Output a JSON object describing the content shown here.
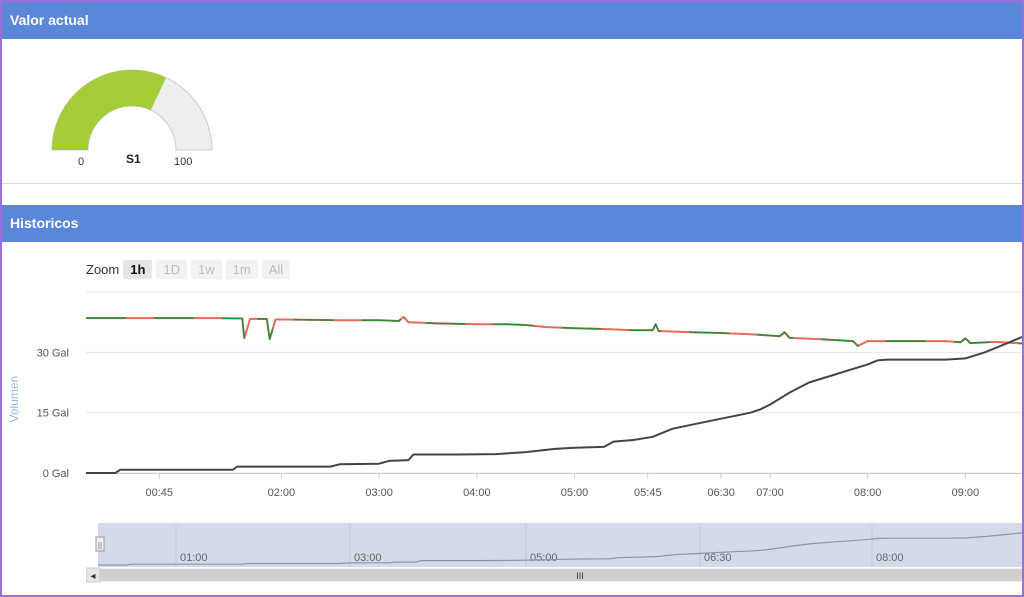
{
  "panels": {
    "current": {
      "title": "Valor actual"
    },
    "history": {
      "title": "Historicos"
    }
  },
  "gauge": {
    "name": "S1",
    "min_label": "0",
    "max_label": "100",
    "value": 64,
    "fill_color": "#a4cd3a",
    "track_color": "#eeeeee"
  },
  "zoom": {
    "label": "Zoom",
    "buttons": [
      {
        "label": "1h",
        "active": true
      },
      {
        "label": "1D",
        "active": false
      },
      {
        "label": "1w",
        "active": false
      },
      {
        "label": "1m",
        "active": false
      },
      {
        "label": "All",
        "active": false
      }
    ]
  },
  "chart_data": {
    "type": "line",
    "ylabel": "Volumen",
    "yticks": [
      "0 Gal",
      "15 Gal",
      "30 Gal"
    ],
    "ylim": [
      0,
      45
    ],
    "xticks": [
      {
        "label": "00:45",
        "t": 0.75
      },
      {
        "label": "02:00",
        "t": 2.0
      },
      {
        "label": "03:00",
        "t": 3.0
      },
      {
        "label": "04:00",
        "t": 4.0
      },
      {
        "label": "05:00",
        "t": 5.0
      },
      {
        "label": "05:45",
        "t": 5.75
      },
      {
        "label": "06:30",
        "t": 6.5
      },
      {
        "label": "07:00",
        "t": 7.0
      },
      {
        "label": "08:00",
        "t": 8.0
      },
      {
        "label": "09:00",
        "t": 9.0
      }
    ],
    "xlim": [
      0.0,
      9.6
    ],
    "series": [
      {
        "color": "#2e8b3a",
        "alt_color": "#e86b5a",
        "points": [
          [
            0.0,
            38.5
          ],
          [
            1.35,
            38.5
          ],
          [
            1.6,
            38.4
          ],
          [
            1.62,
            33.5
          ],
          [
            1.68,
            38.3
          ],
          [
            1.85,
            38.3
          ],
          [
            1.88,
            33.3
          ],
          [
            1.94,
            38.2
          ],
          [
            2.6,
            38.0
          ],
          [
            3.0,
            38.0
          ],
          [
            3.2,
            37.8
          ],
          [
            3.25,
            38.8
          ],
          [
            3.3,
            37.5
          ],
          [
            3.6,
            37.2
          ],
          [
            4.0,
            37.0
          ],
          [
            4.3,
            37.0
          ],
          [
            4.5,
            36.8
          ],
          [
            4.7,
            36.3
          ],
          [
            5.0,
            36.0
          ],
          [
            5.3,
            35.8
          ],
          [
            5.6,
            35.5
          ],
          [
            5.8,
            35.5
          ],
          [
            5.83,
            37.0
          ],
          [
            5.86,
            35.3
          ],
          [
            6.2,
            35.0
          ],
          [
            6.5,
            34.8
          ],
          [
            6.8,
            34.5
          ],
          [
            7.1,
            34.0
          ],
          [
            7.15,
            35.0
          ],
          [
            7.2,
            33.6
          ],
          [
            7.5,
            33.3
          ],
          [
            7.7,
            33.0
          ],
          [
            7.85,
            32.8
          ],
          [
            7.9,
            31.6
          ],
          [
            8.0,
            32.8
          ],
          [
            8.8,
            32.8
          ],
          [
            8.95,
            32.5
          ],
          [
            9.0,
            33.5
          ],
          [
            9.05,
            32.3
          ],
          [
            9.3,
            32.6
          ],
          [
            9.6,
            32.2
          ]
        ]
      },
      {
        "color": "#444444",
        "points": [
          [
            0.0,
            0.0
          ],
          [
            0.3,
            0.0
          ],
          [
            0.35,
            0.8
          ],
          [
            1.5,
            0.8
          ],
          [
            1.55,
            1.6
          ],
          [
            2.5,
            1.6
          ],
          [
            2.6,
            2.2
          ],
          [
            3.0,
            2.3
          ],
          [
            3.1,
            3.0
          ],
          [
            3.3,
            3.2
          ],
          [
            3.35,
            4.6
          ],
          [
            3.8,
            4.6
          ],
          [
            4.2,
            4.7
          ],
          [
            4.5,
            5.2
          ],
          [
            4.8,
            6.0
          ],
          [
            5.0,
            6.3
          ],
          [
            5.3,
            6.5
          ],
          [
            5.4,
            7.8
          ],
          [
            5.6,
            8.2
          ],
          [
            5.8,
            9.0
          ],
          [
            6.0,
            11.0
          ],
          [
            6.2,
            12.0
          ],
          [
            6.4,
            13.0
          ],
          [
            6.6,
            14.0
          ],
          [
            6.8,
            15.0
          ],
          [
            6.9,
            15.8
          ],
          [
            7.0,
            17.0
          ],
          [
            7.2,
            20.0
          ],
          [
            7.4,
            22.5
          ],
          [
            7.6,
            24.0
          ],
          [
            7.8,
            25.5
          ],
          [
            8.0,
            27.0
          ],
          [
            8.1,
            28.0
          ],
          [
            8.2,
            28.2
          ],
          [
            8.8,
            28.2
          ],
          [
            9.0,
            28.5
          ],
          [
            9.2,
            30.0
          ],
          [
            9.4,
            32.0
          ],
          [
            9.6,
            34.0
          ]
        ]
      }
    ]
  },
  "navigator": {
    "labels": [
      "01:00",
      "03:00",
      "05:00",
      "06:30",
      "08:00"
    ],
    "scroll_grip": "III",
    "left_arrow": "◂",
    "handle_grip": "||"
  }
}
